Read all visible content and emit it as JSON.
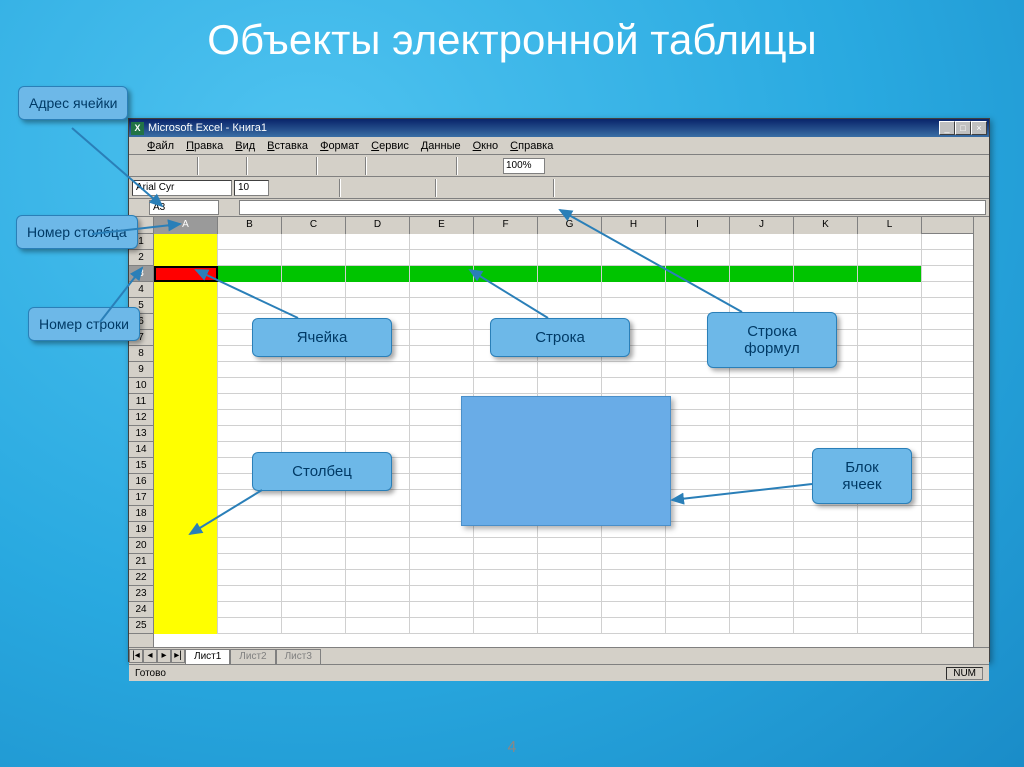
{
  "slide": {
    "title": "Объекты электронной таблицы",
    "number": "4"
  },
  "callouts": {
    "cell_address": "Адрес ячейки",
    "column_number": "Номер столбца",
    "row_number": "Номер строки",
    "cell": "Ячейка",
    "row": "Строка",
    "formula_bar": "Строка формул",
    "column": "Столбец",
    "cell_block": "Блок ячеек"
  },
  "excel": {
    "title": "Microsoft Excel - Книга1",
    "menu": [
      "Файл",
      "Правка",
      "Вид",
      "Вставка",
      "Формат",
      "Сервис",
      "Данные",
      "Окно",
      "Справка"
    ],
    "font": "Arial Cyr",
    "font_size": "10",
    "zoom": "100%",
    "namebox": "A3",
    "columns": [
      "A",
      "B",
      "C",
      "D",
      "E",
      "F",
      "G",
      "H",
      "I",
      "J",
      "K",
      "L"
    ],
    "rows": 25,
    "active_col_index": 0,
    "active_row_index": 2,
    "green_row_index": 2,
    "sheets": [
      "Лист1",
      "Лист2",
      "Лист3"
    ],
    "active_sheet": 0,
    "status": "Готово",
    "numlock": "NUM"
  }
}
